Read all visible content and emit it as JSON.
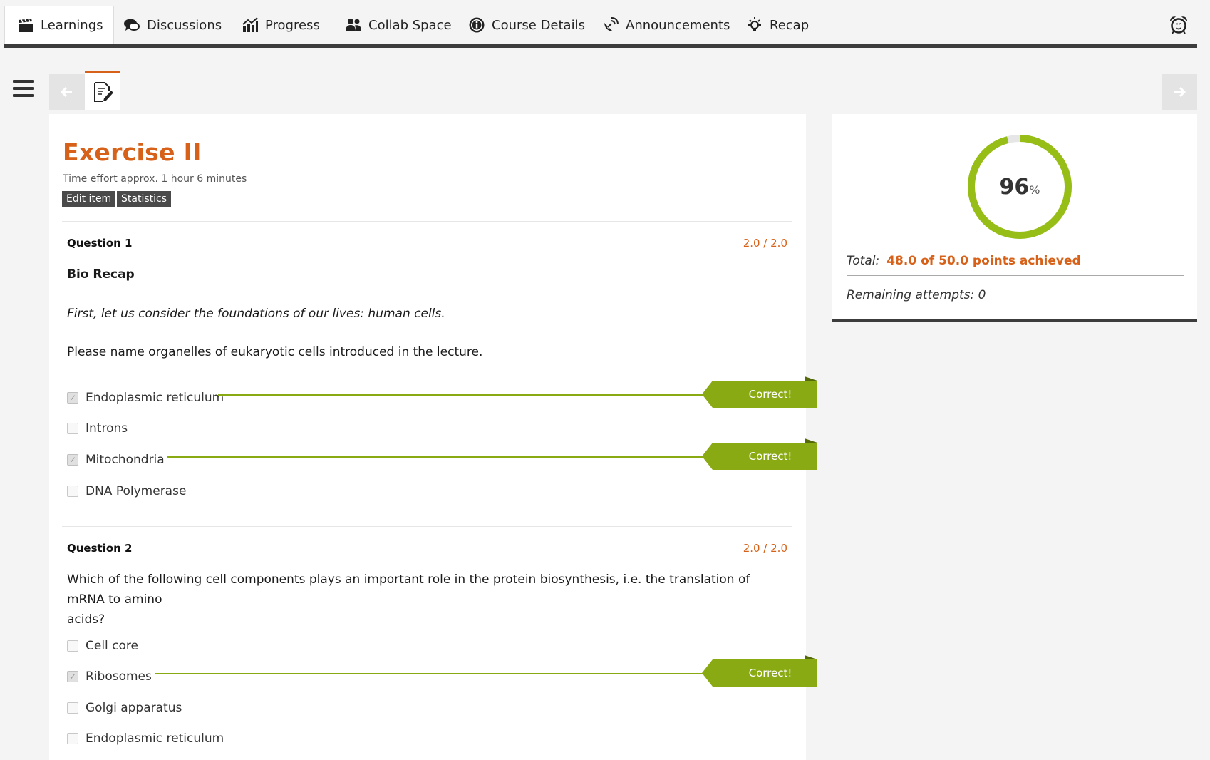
{
  "nav": {
    "tabs": [
      {
        "label": "Learnings",
        "icon": "clapperboard-icon",
        "active": true
      },
      {
        "label": "Discussions",
        "icon": "speech-bubbles-icon"
      },
      {
        "label": "Progress",
        "icon": "bar-chart-icon"
      },
      {
        "label": "Collab Space",
        "icon": "people-icon"
      },
      {
        "label": "Course Details",
        "icon": "info-icon"
      },
      {
        "label": "Announcements",
        "icon": "satellite-dish-icon"
      },
      {
        "label": "Recap",
        "icon": "lightbulb-icon"
      }
    ],
    "alarm_icon": "alarm-clock-icon"
  },
  "exercise": {
    "title": "Exercise II",
    "effort": "Time effort approx. 1 hour 6 minutes",
    "edit_label": "Edit item",
    "stats_label": "Statistics"
  },
  "questions": [
    {
      "label": "Question 1",
      "points": "2.0 / 2.0",
      "title": "Bio Recap",
      "intro": "First, let us consider the foundations of our lives: human cells.",
      "prompt": "Please name organelles of eukaryotic cells introduced in the lecture.",
      "options": [
        {
          "label": "Endoplasmic reticulum",
          "checked": true,
          "feedback": "Correct!"
        },
        {
          "label": "Introns",
          "checked": false
        },
        {
          "label": "Mitochondria",
          "checked": true,
          "feedback": "Correct!"
        },
        {
          "label": "DNA Polymerase",
          "checked": false
        }
      ]
    },
    {
      "label": "Question 2",
      "points": "2.0 / 2.0",
      "prompt_line1": "Which of the following cell components plays an important role in the protein biosynthesis, i.e. the translation of mRNA to amino",
      "prompt_line2": "acids?",
      "options": [
        {
          "label": "Cell core",
          "checked": false
        },
        {
          "label": "Ribosomes",
          "checked": true,
          "feedback": "Correct!"
        },
        {
          "label": "Golgi apparatus",
          "checked": false
        },
        {
          "label": "Endoplasmic reticulum",
          "checked": false
        }
      ]
    }
  ],
  "result": {
    "percent": "96",
    "percent_value": 0.96,
    "percent_sign": "%",
    "total_label": "Total:",
    "total_value": "48.0 of 50.0 points achieved",
    "remaining": "Remaining attempts: 0"
  },
  "colors": {
    "accent": "#d76118",
    "correct": "#8aaa14",
    "dark": "#3c3c3c"
  }
}
